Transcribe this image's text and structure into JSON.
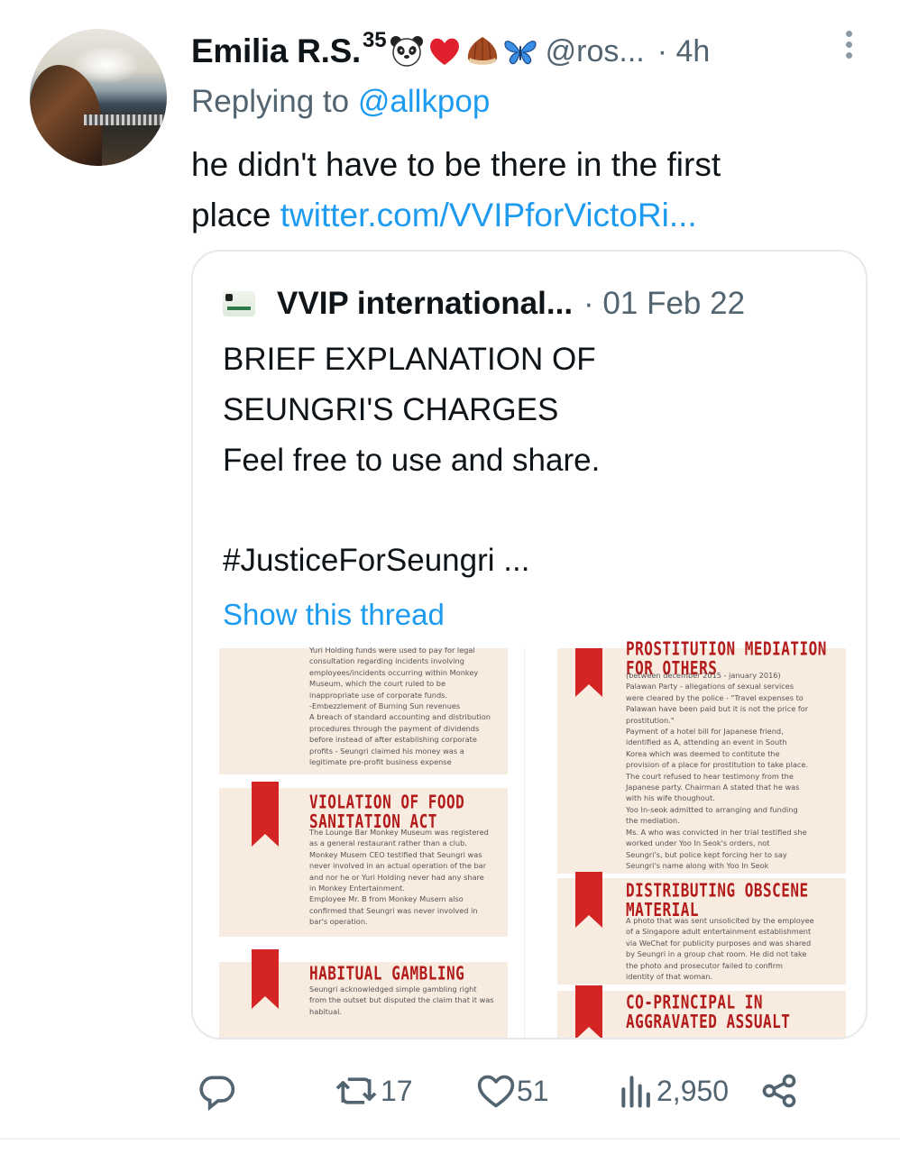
{
  "tweet": {
    "author_name": "Emilia R.S.",
    "author_sup": "35",
    "emojis": [
      "panda-face",
      "red-heart",
      "chestnut",
      "blue-butterfly"
    ],
    "handle": "@ros...",
    "time": "· 4h",
    "reply_prefix": "Replying to",
    "reply_to": "@allkpop",
    "text_line1": "he didn't have to be there in the first",
    "text_line2_prefix": "place",
    "text_link": "twitter.com/VVIPforVictoRi..."
  },
  "quote": {
    "author": "VVIP international...",
    "date": "· 01 Feb 22",
    "lines": [
      "BRIEF EXPLANATION OF",
      "SEUNGRI'S CHARGES",
      "Feel free to use and share.",
      "#JusticeForSeungri ..."
    ],
    "show_thread": "Show this thread",
    "infographic": {
      "left_top_text": [
        "Yuri Holding funds were used to pay for legal",
        "consultation regarding incidents involving",
        "employees/incidents occurring within Monkey",
        "Museum, which the court ruled to be",
        "inappropriate use of corporate funds.",
        "-Embezzlement of Burning Sun revenues",
        "A breach of standard accounting and distribution",
        "procedures through the payment of dividends",
        "before instead of after establishing corporate",
        "profits - Seungri claimed his money was a",
        "legitimate pre-profit business expense"
      ],
      "food_title_1": "VIOLATION OF FOOD",
      "food_title_2": "SANITATION ACT",
      "food_text": [
        "The Lounge Bar Monkey Museum was registered",
        "as a general restaurant rather than a club.",
        "Monkey Musem CEO testified that Seungri was",
        "never involved in an actual operation of the bar",
        "and nor he or Yuri Holding never had any share",
        "in Monkey Entertainment.",
        "Employee Mr. B from Monkey Musem also",
        "confirmed that Seungri was never involved in",
        "bar's operation."
      ],
      "gambling_title": "HABITUAL GAMBLING",
      "gambling_text": [
        "Seungri acknowledged simple gambling right",
        "from the outset but disputed the claim that it was",
        "habitual."
      ],
      "prostitution_title_1": "PROSTITUTION MEDIATION",
      "prostitution_title_2": "FOR OTHERS",
      "prostitution_text": [
        "(between december 2015 - january 2016)",
        "Palawan Party - allegations of sexual services",
        "were cleared by the police - \"Travel expenses to",
        "Palawan have been paid but it is not the price for",
        "prostitution.\"",
        "Payment of a hotel bill for Japanese friend,",
        "identified as A, attending an event in South",
        "Korea which was deemed to contitute the",
        "provision of a place for prostitution to take place.",
        "The court refused to hear testimony from the",
        "Japanese party. Chairman A stated that he was",
        "with his wife thoughout.",
        "Yoo In-seok admitted to arranging and funding",
        "the mediation.",
        "Ms. A who was convicted in her trial testified she",
        "worked under Yoo In Seok's orders, not",
        "Seungri's, but police kept forcing her to say",
        "Seungri's name along with Yoo In Seok"
      ],
      "obscene_title_1": "DISTRIBUTING OBSCENE",
      "obscene_title_2": "MATERIAL",
      "obscene_text": [
        "A photo that was sent unsolicited by the employee",
        "of a Singapore adult entertainment establishment",
        "via WeChat for publicity purposes and was shared",
        "by Seungri in a group chat room. He did not take",
        "the photo and prosecutor failed to confirm",
        "identity of that woman."
      ],
      "coprincipal_title_1": "CO-PRINCIPAL IN",
      "coprincipal_title_2": "AGGRAVATED ASSUALT"
    }
  },
  "actions": {
    "retweets": "17",
    "likes": "51",
    "views": "2,950"
  },
  "colors": {
    "link": "#1d9bf0",
    "muted": "#536471",
    "ribbon": "#d42424",
    "panel": "#f8ebe0"
  }
}
